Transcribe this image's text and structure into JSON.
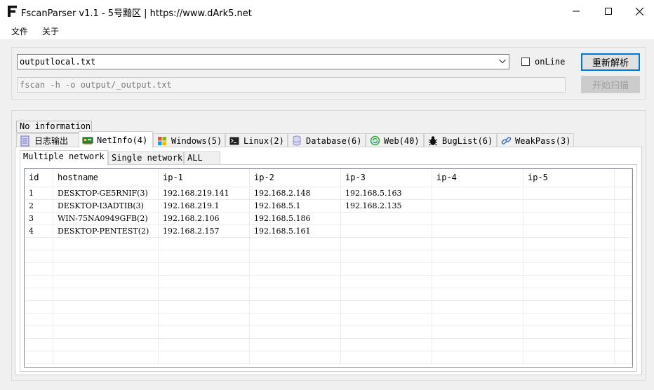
{
  "window": {
    "title": "FscanParser v1.1 - 5号黯区 | https://www.dArk5.net"
  },
  "menu": {
    "items": [
      "文件",
      "关于"
    ]
  },
  "top": {
    "file_value": "outputlocal.txt",
    "command_value": "fscan -h -o output/_output.txt",
    "online_label": "onLine",
    "online_checked": false,
    "reparse_label": "重新解析",
    "scan_label": "开始扫描"
  },
  "info_label": "No information",
  "tabs": [
    {
      "label": "日志输出",
      "icon": "log-file-icon"
    },
    {
      "label": "NetInfo(4)",
      "icon": "network-card-icon"
    },
    {
      "label": "Windows(5)",
      "icon": "windows-logo-icon"
    },
    {
      "label": "Linux(2)",
      "icon": "terminal-icon"
    },
    {
      "label": "Database(6)",
      "icon": "database-icon"
    },
    {
      "label": "Web(40)",
      "icon": "web-refresh-icon"
    },
    {
      "label": "BugList(6)",
      "icon": "bug-icon"
    },
    {
      "label": "WeakPass(3)",
      "icon": "link-icon"
    }
  ],
  "active_tab": "NetInfo(4)",
  "subtabs": [
    "Multiple network",
    "Single network",
    "ALL"
  ],
  "active_subtab": "Multiple network",
  "table": {
    "columns": [
      "id",
      "hostname",
      "ip-1",
      "ip-2",
      "ip-3",
      "ip-4",
      "ip-5"
    ],
    "rows": [
      [
        "1",
        "DESKTOP-GE5RNIF(3)",
        "192.168.219.141",
        "192.168.2.148",
        "192.168.5.163",
        "",
        ""
      ],
      [
        "2",
        "DESKTOP-I3ADTIB(3)",
        "192.168.219.1",
        "192.168.5.1",
        "192.168.2.135",
        "",
        ""
      ],
      [
        "3",
        "WIN-75NA0949GFB(2)",
        "192.168.2.106",
        "192.168.5.186",
        "",
        "",
        ""
      ],
      [
        "4",
        "DESKTOP-PENTEST(2)",
        "192.168.2.157",
        "192.168.5.161",
        "",
        "",
        ""
      ]
    ]
  }
}
